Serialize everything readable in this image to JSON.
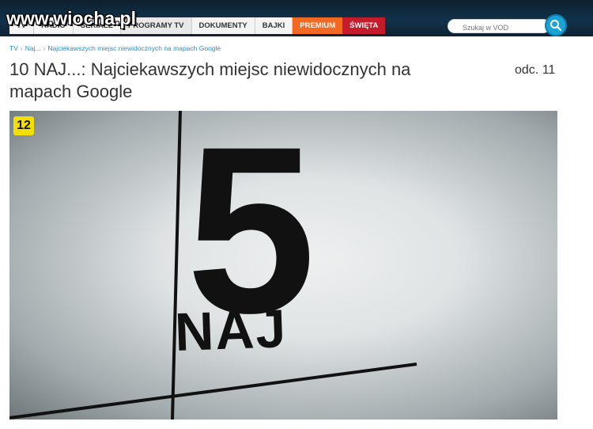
{
  "watermark": "www.wiocha.pl",
  "nav": {
    "items": [
      {
        "label": "TV"
      },
      {
        "label": "RADIO"
      },
      {
        "label": "SERIALE"
      },
      {
        "label": "PROGRAMY TV"
      },
      {
        "label": "DOKUMENTY"
      },
      {
        "label": "BAJKI"
      },
      {
        "label": "PREMIUM"
      },
      {
        "label": "ŚWIĘTA"
      }
    ]
  },
  "search": {
    "placeholder": "Szukaj w VOD",
    "icon": "search-icon"
  },
  "breadcrumb": {
    "items": [
      "TV",
      "Naj...",
      "Najciekawszych miejsc niewidocznych na mapach Google"
    ],
    "separator": "›"
  },
  "page": {
    "title": "10 NAJ...: Najciekawszych miejsc niewidocznych na mapach Google",
    "episode": "odc. 11"
  },
  "player": {
    "age_rating": "12",
    "big_number": "5",
    "show_text": "NAJ",
    "colors": {
      "badge": "#f4e000",
      "ink": "#111111"
    }
  },
  "colors": {
    "premium": "#f26a21",
    "swieta": "#c51b2b",
    "link": "#2a8fc3",
    "search_button": "#1aa3d6"
  }
}
